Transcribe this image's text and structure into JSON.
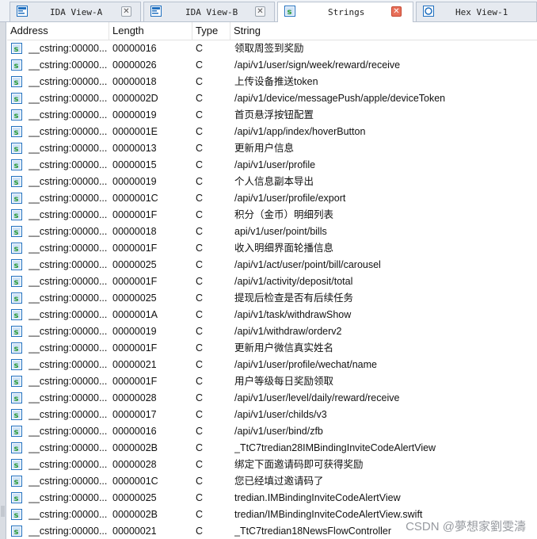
{
  "tabs": [
    {
      "label": "IDA View-A",
      "active": false,
      "icon": "ida-view-icon"
    },
    {
      "label": "IDA View-B",
      "active": false,
      "icon": "ida-view-icon"
    },
    {
      "label": "Strings",
      "active": true,
      "icon": "strings-icon"
    },
    {
      "label": "Hex View-1",
      "active": false,
      "icon": "hex-view-icon"
    }
  ],
  "columns": {
    "address": "Address",
    "length": "Length",
    "type": "Type",
    "string": "String"
  },
  "rows": [
    {
      "address": "__cstring:00000...",
      "length": "00000016",
      "type": "C",
      "string": "领取周签到奖励"
    },
    {
      "address": "__cstring:00000...",
      "length": "00000026",
      "type": "C",
      "string": "/api/v1/user/sign/week/reward/receive"
    },
    {
      "address": "__cstring:00000...",
      "length": "00000018",
      "type": "C",
      "string": "上传设备推送token"
    },
    {
      "address": "__cstring:00000...",
      "length": "0000002D",
      "type": "C",
      "string": "/api/v1/device/messagePush/apple/deviceToken"
    },
    {
      "address": "__cstring:00000...",
      "length": "00000019",
      "type": "C",
      "string": "首页悬浮按钮配置"
    },
    {
      "address": "__cstring:00000...",
      "length": "0000001E",
      "type": "C",
      "string": "/api/v1/app/index/hoverButton"
    },
    {
      "address": "__cstring:00000...",
      "length": "00000013",
      "type": "C",
      "string": "更新用户信息"
    },
    {
      "address": "__cstring:00000...",
      "length": "00000015",
      "type": "C",
      "string": "/api/v1/user/profile"
    },
    {
      "address": "__cstring:00000...",
      "length": "00000019",
      "type": "C",
      "string": "个人信息副本导出"
    },
    {
      "address": "__cstring:00000...",
      "length": "0000001C",
      "type": "C",
      "string": "/api/v1/user/profile/export"
    },
    {
      "address": "__cstring:00000...",
      "length": "0000001F",
      "type": "C",
      "string": "积分（金币）明细列表"
    },
    {
      "address": "__cstring:00000...",
      "length": "00000018",
      "type": "C",
      "string": "api/v1/user/point/bills"
    },
    {
      "address": "__cstring:00000...",
      "length": "0000001F",
      "type": "C",
      "string": "收入明细界面轮播信息"
    },
    {
      "address": "__cstring:00000...",
      "length": "00000025",
      "type": "C",
      "string": "/api/v1/act/user/point/bill/carousel"
    },
    {
      "address": "__cstring:00000...",
      "length": "0000001F",
      "type": "C",
      "string": "/api/v1/activity/deposit/total"
    },
    {
      "address": "__cstring:00000...",
      "length": "00000025",
      "type": "C",
      "string": "提现后检查是否有后续任务"
    },
    {
      "address": "__cstring:00000...",
      "length": "0000001A",
      "type": "C",
      "string": "/api/v1/task/withdrawShow"
    },
    {
      "address": "__cstring:00000...",
      "length": "00000019",
      "type": "C",
      "string": "/api/v1/withdraw/orderv2"
    },
    {
      "address": "__cstring:00000...",
      "length": "0000001F",
      "type": "C",
      "string": "更新用户微信真实姓名"
    },
    {
      "address": "__cstring:00000...",
      "length": "00000021",
      "type": "C",
      "string": "/api/v1/user/profile/wechat/name"
    },
    {
      "address": "__cstring:00000...",
      "length": "0000001F",
      "type": "C",
      "string": "用户等级每日奖励领取"
    },
    {
      "address": "__cstring:00000...",
      "length": "00000028",
      "type": "C",
      "string": "/api/v1/user/level/daily/reward/receive"
    },
    {
      "address": "__cstring:00000...",
      "length": "00000017",
      "type": "C",
      "string": "/api/v1/user/childs/v3"
    },
    {
      "address": "__cstring:00000...",
      "length": "00000016",
      "type": "C",
      "string": "/api/v1/user/bind/zfb"
    },
    {
      "address": "__cstring:00000...",
      "length": "0000002B",
      "type": "C",
      "string": "_TtC7tredian28IMBindingInviteCodeAlertView"
    },
    {
      "address": "__cstring:00000...",
      "length": "00000028",
      "type": "C",
      "string": "绑定下面邀请码即可获得奖励"
    },
    {
      "address": "__cstring:00000...",
      "length": "0000001C",
      "type": "C",
      "string": "您已经填过邀请码了"
    },
    {
      "address": "__cstring:00000...",
      "length": "00000025",
      "type": "C",
      "string": "tredian.IMBindingInviteCodeAlertView"
    },
    {
      "address": "__cstring:00000...",
      "length": "0000002B",
      "type": "C",
      "string": "tredian/IMBindingInviteCodeAlertView.swift"
    },
    {
      "address": "__cstring:00000...",
      "length": "00000021",
      "type": "C",
      "string": "_TtC7tredian18NewsFlowController"
    }
  ],
  "watermark": "CSDN @夢想家劉雯濤",
  "colors": {
    "tab_bar": "#eef1f6",
    "close_active": "#e8705a",
    "icon_blue": "#1f6fbf",
    "icon_green": "#2c9a3a"
  }
}
